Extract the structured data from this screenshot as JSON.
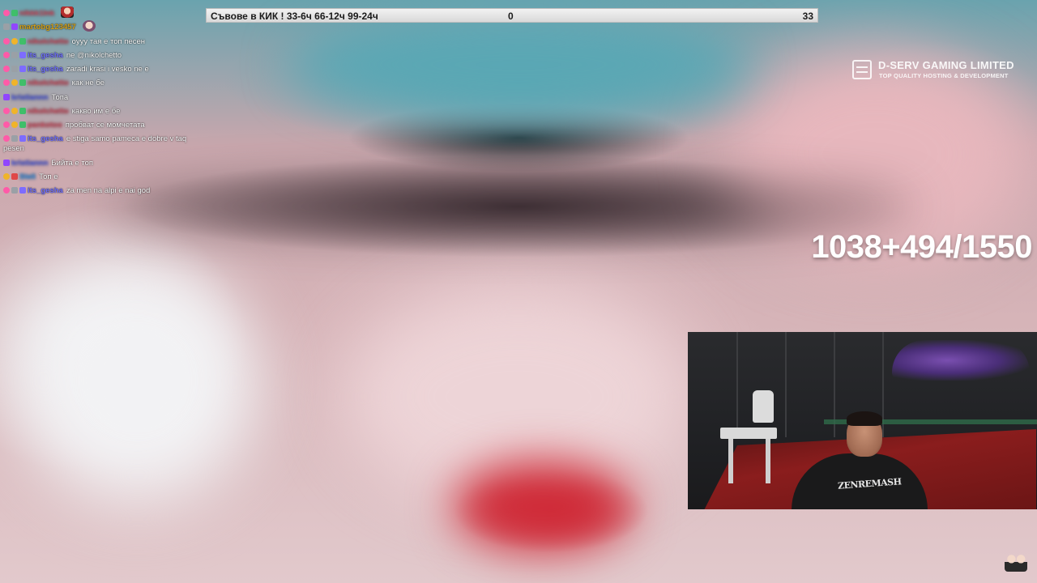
{
  "goal_bar": {
    "title": "Съвове в КИК ! 33-6ч 66-12ч 99-24ч",
    "current": "0",
    "target": "33"
  },
  "chat": {
    "messages": [
      {
        "user": "nikkk1Ink",
        "text": "",
        "badges": [
          "heart-badge",
          "sub-badge"
        ],
        "user_color": "#e8556a",
        "user_blurred": true,
        "emote": "red-emote"
      },
      {
        "user": "martobg123457",
        "text": "",
        "badges": [
          "wrench-badge",
          "prime-badge"
        ],
        "user_color": "#d4a017",
        "user_blurred": false,
        "emote": "face-emote"
      },
      {
        "user": "nikolchetto",
        "text": "оууу тая е топ песен",
        "badges": [
          "heart-badge",
          "bits-badge",
          "sub-badge"
        ],
        "user_color": "#e8556a",
        "user_blurred": true
      },
      {
        "user": "its_gesha",
        "text": "ne @nikolchetto",
        "badges": [
          "heart-badge",
          "wrench-badge",
          "mod-badge"
        ],
        "user_color": "#6f6fff",
        "user_blurred": false
      },
      {
        "user": "its_gesha",
        "text": "zaradi krasi i vesko ne e",
        "badges": [
          "heart-badge",
          "wrench-badge",
          "mod-badge"
        ],
        "user_color": "#6f6fff",
        "user_blurred": false
      },
      {
        "user": "nikolchetto",
        "text": "как не бе",
        "badges": [
          "heart-badge",
          "bits-badge",
          "sub-badge"
        ],
        "user_color": "#e8556a",
        "user_blurred": true
      },
      {
        "user": "kristiannn",
        "text": "Топа",
        "badges": [
          "prime-badge"
        ],
        "user_color": "#5b6bff",
        "user_blurred": true
      },
      {
        "user": "nikolchetto",
        "text": "какво им е бе",
        "badges": [
          "heart-badge",
          "bits-badge",
          "sub-badge"
        ],
        "user_color": "#e8556a",
        "user_blurred": true
      },
      {
        "user": "pankotoo",
        "text": "пробват се момчетата",
        "badges": [
          "heart-badge",
          "bits-badge",
          "sub-badge"
        ],
        "user_color": "#e8556a",
        "user_blurred": true
      },
      {
        "user": "its_gesha",
        "text": "e stiga samo pameca e dobre v taq pesen",
        "badges": [
          "heart-badge",
          "wrench-badge",
          "mod-badge"
        ],
        "user_color": "#6f6fff",
        "user_blurred": false,
        "wrap": true
      },
      {
        "user": "kristiannn",
        "text": "Бийта е топ",
        "badges": [
          "prime-badge"
        ],
        "user_color": "#5b6bff",
        "user_blurred": true
      },
      {
        "user": "Steli",
        "text": "Топ е",
        "badges": [
          "bits-badge",
          "turbo-badge"
        ],
        "user_color": "#3aa0ff",
        "user_blurred": true
      },
      {
        "user": "its_gesha",
        "text": "za men na alpi e nai god",
        "badges": [
          "heart-badge",
          "wrench-badge",
          "mod-badge"
        ],
        "user_color": "#6f6fff",
        "user_blurred": false
      }
    ]
  },
  "sponsor": {
    "name": "D-SERV GAMING LIMITED",
    "tagline": "TOP QUALITY HOSTING & DEVELOPMENT",
    "icon": "server-icon"
  },
  "counter": {
    "text": "1038+494/1550"
  },
  "webcam": {
    "shirt_text": "ZENREMASH"
  },
  "colors": {
    "goal_bar_bg": "#e6e6e6",
    "counter_text": "#ffffff",
    "webcam_bg": "#1f2023"
  }
}
